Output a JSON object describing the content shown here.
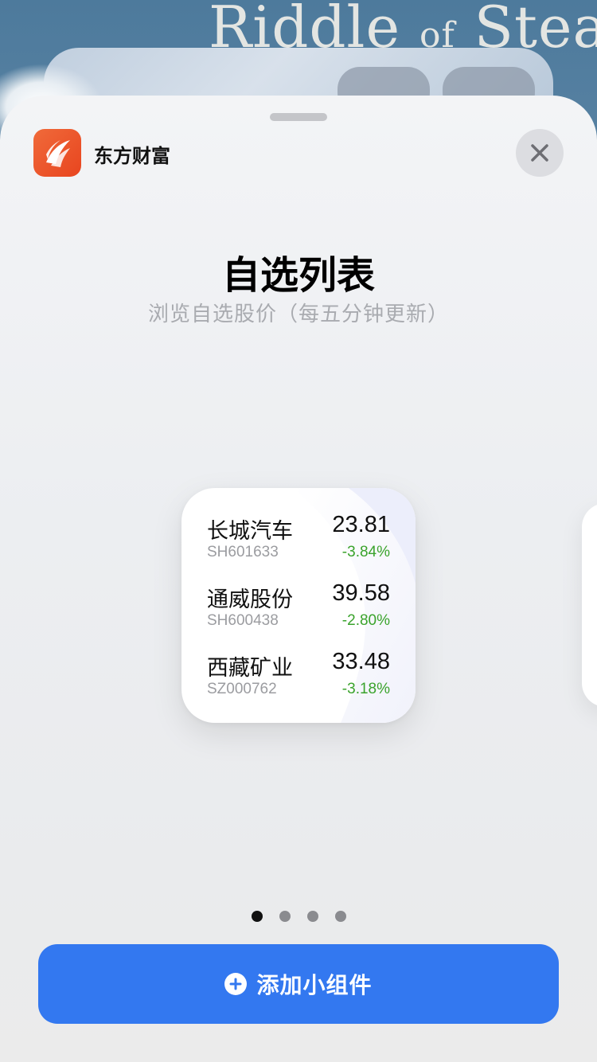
{
  "background_app": {
    "title_part1": "Riddle",
    "title_part2": "of",
    "title_part3": "Stea"
  },
  "sheet": {
    "app_name": "东方财富",
    "app_icon": "eastmoney-logo-icon",
    "close_icon": "close-icon",
    "title": "自选列表",
    "subtitle": "浏览自选股价（每五分钟更新）"
  },
  "widget": {
    "stocks": [
      {
        "name": "长城汽车",
        "code": "SH601633",
        "price": "23.81",
        "change": "-3.84%"
      },
      {
        "name": "通威股份",
        "code": "SH600438",
        "price": "39.58",
        "change": "-2.80%"
      },
      {
        "name": "西藏矿业",
        "code": "SZ000762",
        "price": "33.48",
        "change": "-3.18%"
      }
    ]
  },
  "pagination": {
    "total": 4,
    "active_index": 0
  },
  "add_button": {
    "label": "添加小组件",
    "icon": "plus-circle-icon"
  },
  "colors": {
    "accent": "#3378f0",
    "brand": "#e8451f",
    "change_green": "#3aa32c"
  }
}
